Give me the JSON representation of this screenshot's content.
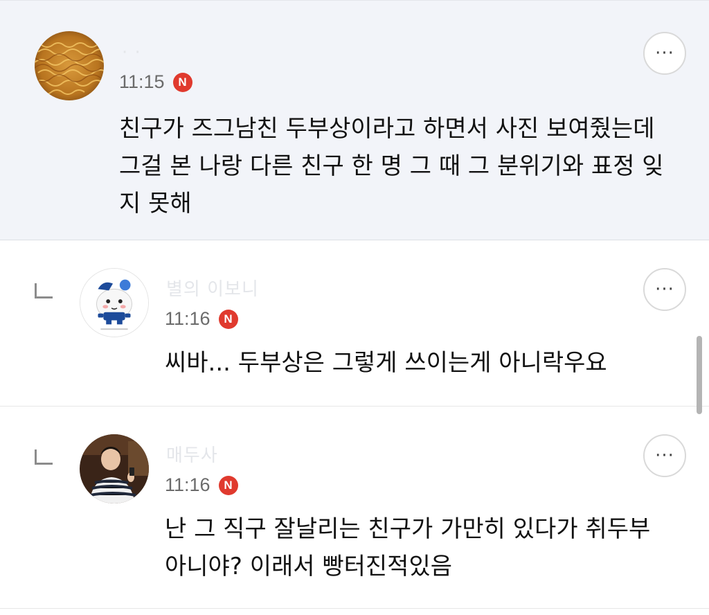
{
  "comments": [
    {
      "nickname": "· ·",
      "time": "11:15",
      "badge": "N",
      "text": "친구가 즈그남친 두부상이라고 하면서 사진 보여줬는데 그걸 본 나랑 다른 친구 한 명 그 때 그 분위기와 표정 잊지 못해",
      "more_icon": "···",
      "is_reply": false
    },
    {
      "nickname": "별의 이보니",
      "time": "11:16",
      "badge": "N",
      "text": "씨바... 두부상은 그렇게 쓰이는게 아니락우요",
      "more_icon": "···",
      "is_reply": true
    },
    {
      "nickname": "매두사",
      "time": "11:16",
      "badge": "N",
      "text": "난 그 직구 잘날리는 친구가 가만히 있다가 취두부 아니야? 이래서 빵터진적있음",
      "more_icon": "···",
      "is_reply": true
    }
  ],
  "colors": {
    "highlight_bg": "#f2f4f9",
    "badge": "#e03a2e",
    "time": "#6b6b6b"
  }
}
